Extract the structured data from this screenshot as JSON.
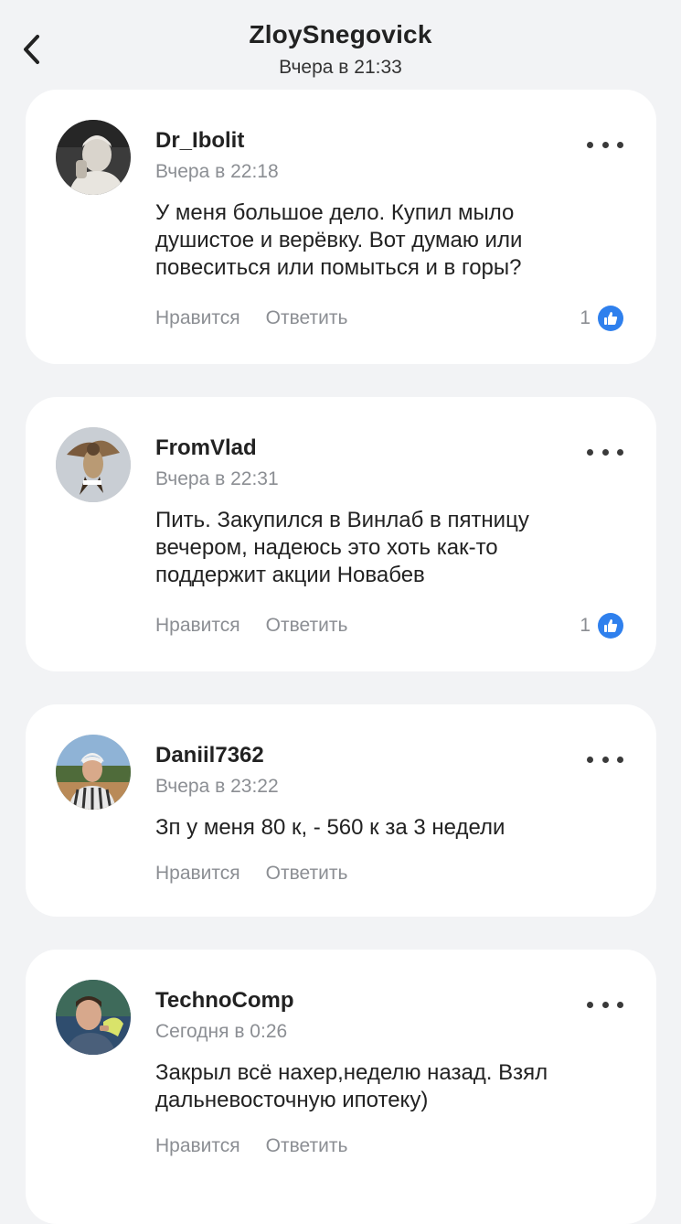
{
  "header": {
    "title": "ZloySnegovick",
    "subtitle": "Вчера в 21:33"
  },
  "actions": {
    "like_label": "Нравится",
    "reply_label": "Ответить"
  },
  "comments": [
    {
      "author": "Dr_Ibolit",
      "time": "Вчера в 22:18",
      "text": "У меня большое дело. Купил мыло\nдушистое и верёвку. Вот думаю или\nповеситься или помыться и в горы?",
      "likes": "1"
    },
    {
      "author": "FromVlad",
      "time": "Вчера в 22:31",
      "text": "Пить. Закупился в Винлаб в пятницу\nвечером, надеюсь это хоть как-то\nподдержит акции Новабев",
      "likes": "1"
    },
    {
      "author": "Daniil7362",
      "time": "Вчера в 23:22",
      "text": "Зп у меня 80 к, - 560 к за 3 недели"
    },
    {
      "author": "TechnoComp",
      "time": "Сегодня в 0:26",
      "text": "Закрыл всё нахер,неделю назад. Взял\nдальневосточную ипотеку)"
    }
  ]
}
